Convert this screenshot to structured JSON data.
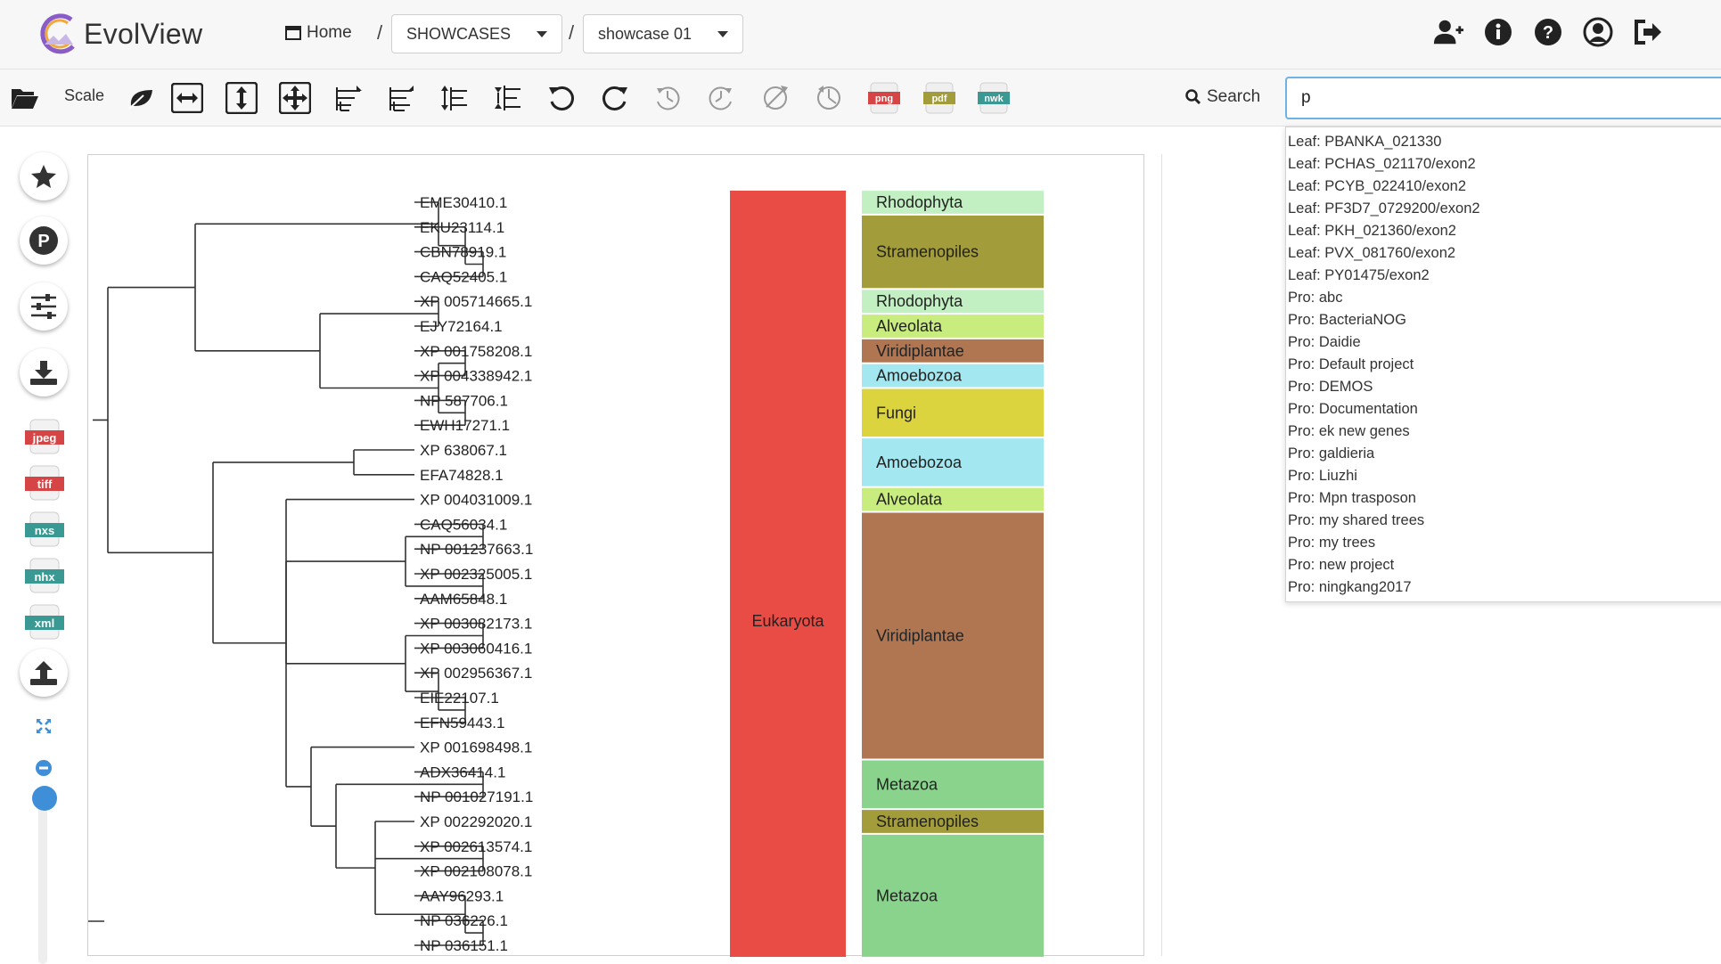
{
  "app": {
    "name": "EvolView"
  },
  "nav": {
    "home": "Home",
    "sep": "/",
    "category": "SHOWCASES",
    "tree": "showcase 01",
    "icons": [
      "add-user-icon",
      "info-icon",
      "help-icon",
      "account-icon",
      "logout-icon"
    ]
  },
  "toolbar": {
    "scale_label": "Scale",
    "search_label": "Search",
    "search_value": "p",
    "formats": [
      "png",
      "pdf",
      "nwk"
    ]
  },
  "side": {
    "formats": [
      "jpeg",
      "tiff",
      "nxs",
      "nhx",
      "xml"
    ]
  },
  "search_results": [
    "Leaf: PBANKA_021330",
    "Leaf: PCHAS_021170/exon2",
    "Leaf: PCYB_022410/exon2",
    "Leaf: PF3D7_0729200/exon2",
    "Leaf: PKH_021360/exon2",
    "Leaf: PVX_081760/exon2",
    "Leaf: PY01475/exon2",
    "Pro: abc",
    "Pro: BacteriaNOG",
    "Pro: Daidie",
    "Pro: Default project",
    "Pro: DEMOS",
    "Pro: Documentation",
    "Pro: ek new genes",
    "Pro: galdieria",
    "Pro: Liuzhi",
    "Pro: Mpn trasposon",
    "Pro: my shared trees",
    "Pro: my trees",
    "Pro: new project",
    "Pro: ningkang2017"
  ],
  "tree": {
    "leaves": [
      "EME30410.1",
      "EKU23114.1",
      "CBN78919.1",
      "CAQ52405.1",
      "XP 005714665.1",
      "EJY72164.1",
      "XP 001758208.1",
      "XP 004338942.1",
      "NP 587706.1",
      "EWH17271.1",
      "XP 638067.1",
      "EFA74828.1",
      "XP 004031009.1",
      "CAQ56034.1",
      "NP 001237663.1",
      "XP 002325005.1",
      "AAM65848.1",
      "XP 003082173.1",
      "XP 003060416.1",
      "XP 002956367.1",
      "EIE22107.1",
      "EFN59443.1",
      "XP 001698498.1",
      "ADX36414.1",
      "NP 001027191.1",
      "XP 002292020.1",
      "XP 002613574.1",
      "XP 002108078.1",
      "AAY96293.1",
      "NP 036226.1",
      "NP 036151.1"
    ],
    "domain": {
      "label": "Eukaryota",
      "color": "#e84c44"
    },
    "groups": [
      {
        "label": "Rhodophyta",
        "start": 0,
        "end": 0,
        "color": "#c3f0c3"
      },
      {
        "label": "Stramenopiles",
        "start": 1,
        "end": 3,
        "color": "#a29c3a"
      },
      {
        "label": "Rhodophyta",
        "start": 4,
        "end": 4,
        "color": "#c3f0c3"
      },
      {
        "label": "Alveolata",
        "start": 5,
        "end": 5,
        "color": "#c8ec7e"
      },
      {
        "label": "Viridiplantae",
        "start": 6,
        "end": 6,
        "color": "#b07651"
      },
      {
        "label": "Amoebozoa",
        "start": 7,
        "end": 7,
        "color": "#a3e8f0"
      },
      {
        "label": "Fungi",
        "start": 8,
        "end": 9,
        "color": "#dcd43e"
      },
      {
        "label": "Amoebozoa",
        "start": 10,
        "end": 11,
        "color": "#a3e8f0"
      },
      {
        "label": "Alveolata",
        "start": 12,
        "end": 12,
        "color": "#c8ec7e"
      },
      {
        "label": "Viridiplantae",
        "start": 13,
        "end": 22,
        "color": "#b07651"
      },
      {
        "label": "Metazoa",
        "start": 23,
        "end": 24,
        "color": "#8ad38c"
      },
      {
        "label": "Stramenopiles",
        "start": 25,
        "end": 25,
        "color": "#a29c3a"
      },
      {
        "label": "Metazoa",
        "start": 26,
        "end": 30,
        "color": "#8ad38c"
      }
    ]
  }
}
